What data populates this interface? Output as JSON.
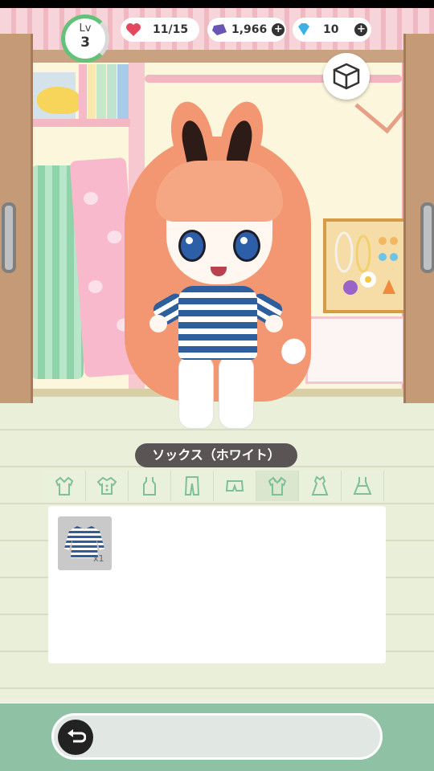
{
  "hud": {
    "level_label": "Lv",
    "level_value": "3",
    "hearts": "11/15",
    "gems": "1,966",
    "diamonds": "10",
    "plus_symbol": "+"
  },
  "icons": {
    "heart": "heart-icon",
    "gem": "gem-icon",
    "diamond": "diamond-icon",
    "wardrobe": "wardrobe-box-icon",
    "back": "back-arrow-icon"
  },
  "item_name": "ソックス（ホワイト）",
  "categories": [
    {
      "name": "cardigan"
    },
    {
      "name": "blouse"
    },
    {
      "name": "tank-top"
    },
    {
      "name": "pants"
    },
    {
      "name": "shorts"
    },
    {
      "name": "shirt-collar"
    },
    {
      "name": "dress"
    },
    {
      "name": "one-piece"
    }
  ],
  "inventory": {
    "items": [
      {
        "name": "striped-dress",
        "count": "x1"
      }
    ]
  },
  "colors": {
    "accent_green": "#63c17a",
    "bottom_bar": "#8fc2a4",
    "hair": "#f29771",
    "stripe_blue": "#2f5e9d"
  }
}
